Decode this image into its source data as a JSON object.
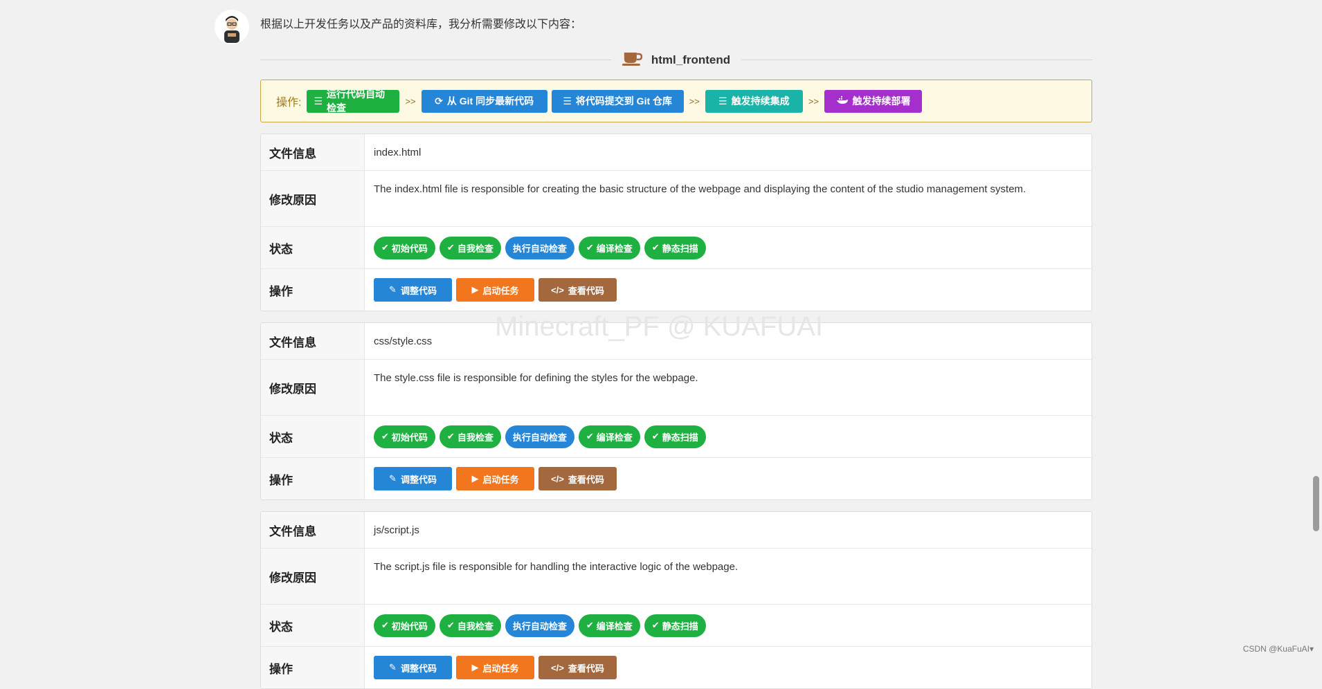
{
  "intro_text": "根据以上开发任务以及产品的资料库，我分析需要修改以下内容：",
  "section_title": "html_frontend",
  "ops": {
    "label": "操作:",
    "arrow": ">>",
    "buttons": [
      {
        "label": "运行代码自动检查",
        "icon": "list-icon"
      },
      {
        "label": "从 Git 同步最新代码",
        "icon": "sync-icon"
      },
      {
        "label": "将代码提交到 Git 仓库",
        "icon": "list-icon"
      },
      {
        "label": "触发持续集成",
        "icon": "list-icon"
      },
      {
        "label": "触发持续部署",
        "icon": "docker-icon"
      }
    ]
  },
  "labels": {
    "file_info": "文件信息",
    "reason": "修改原因",
    "status": "状态",
    "actions": "操作"
  },
  "status_pills": [
    "初始代码",
    "自我检查",
    "执行自动检查",
    "编译检查",
    "静态扫描"
  ],
  "action_buttons": [
    "调整代码",
    "启动任务",
    "查看代码"
  ],
  "files": [
    {
      "name": "index.html",
      "reason": "The index.html file is responsible for creating the basic structure of the webpage and displaying the content of the studio management system."
    },
    {
      "name": "css/style.css",
      "reason": "The style.css file is responsible for defining the styles for the webpage."
    },
    {
      "name": "js/script.js",
      "reason": "The script.js file is responsible for handling the interactive logic of the webpage."
    }
  ],
  "watermark": "Minecraft_PF @ KUAFUAI",
  "footer_credit": "CSDN @KuaFuAI",
  "colors": {
    "green": "#1fb042",
    "blue": "#2585d6",
    "teal": "#19b3a8",
    "purple": "#a52fcc",
    "orange": "#f2761e",
    "brown": "#a4683f"
  }
}
